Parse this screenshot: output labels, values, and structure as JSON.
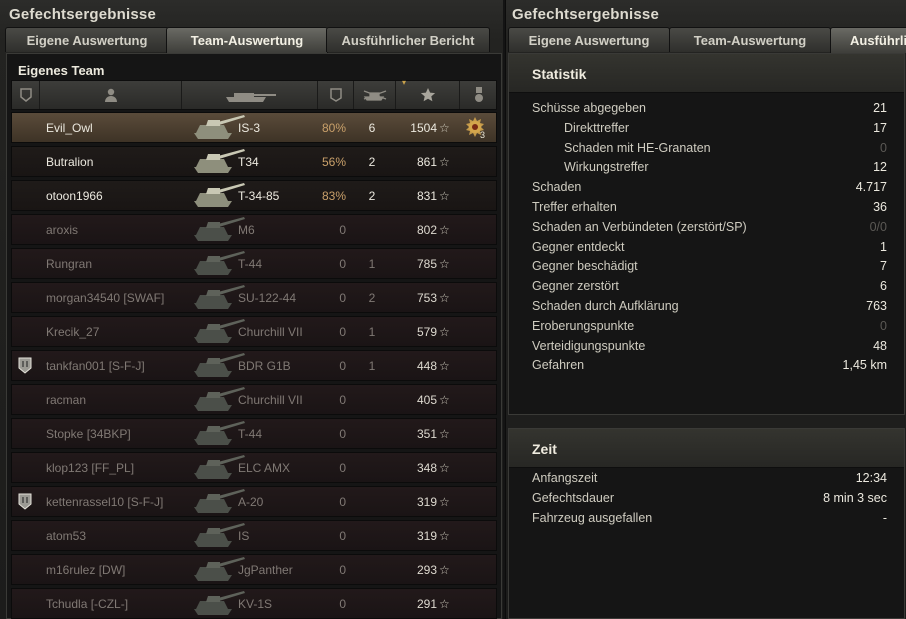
{
  "left": {
    "title": "Gefechtsergebnisse",
    "tabs": [
      "Eigene Auswertung",
      "Team-Auswertung",
      "Ausführlicher Bericht"
    ],
    "team_title": "Eigenes Team",
    "header_icons": [
      "platoon-column-icon",
      "player-column-icon",
      "tank-column-icon",
      "damage-column-icon",
      "kills-column-icon",
      "xp-column-icon",
      "medal-column-icon"
    ],
    "rows": [
      {
        "name": "Evil_Owl",
        "tank": "IS-3",
        "damage_pct": "80%",
        "kills": "6",
        "xp": "1504",
        "state": "self",
        "platoon": false,
        "medal": true,
        "medal_count": "3"
      },
      {
        "name": "Butralion",
        "tank": "T34",
        "damage_pct": "56%",
        "kills": "2",
        "xp": "861",
        "state": "alive",
        "platoon": false
      },
      {
        "name": "otoon1966",
        "tank": "T-34-85",
        "damage_pct": "83%",
        "kills": "2",
        "xp": "831",
        "state": "alive",
        "platoon": false
      },
      {
        "name": "aroxis",
        "tank": "M6",
        "damage_pct": "0",
        "kills": "",
        "xp": "802",
        "state": "dead",
        "platoon": false
      },
      {
        "name": "Rungran",
        "tank": "T-44",
        "damage_pct": "0",
        "kills": "1",
        "xp": "785",
        "state": "dead",
        "platoon": false
      },
      {
        "name": "morgan34540 [SWAF]",
        "tank": "SU-122-44",
        "damage_pct": "0",
        "kills": "2",
        "xp": "753",
        "state": "dead",
        "platoon": false
      },
      {
        "name": "Krecik_27",
        "tank": "Churchill VII",
        "damage_pct": "0",
        "kills": "1",
        "xp": "579",
        "state": "dead",
        "platoon": false
      },
      {
        "name": "tankfan001 [S-F-J]",
        "tank": "BDR G1B",
        "damage_pct": "0",
        "kills": "1",
        "xp": "448",
        "state": "dead",
        "platoon": true
      },
      {
        "name": "racman",
        "tank": "Churchill VII",
        "damage_pct": "0",
        "kills": "",
        "xp": "405",
        "state": "dead",
        "platoon": false
      },
      {
        "name": "Stopke [34BKP]",
        "tank": "T-44",
        "damage_pct": "0",
        "kills": "",
        "xp": "351",
        "state": "dead",
        "platoon": false
      },
      {
        "name": "klop123 [FF_PL]",
        "tank": "ELC AMX",
        "damage_pct": "0",
        "kills": "",
        "xp": "348",
        "state": "dead",
        "platoon": false
      },
      {
        "name": "kettenrassel10 [S-F-J]",
        "tank": "A-20",
        "damage_pct": "0",
        "kills": "",
        "xp": "319",
        "state": "dead",
        "platoon": true
      },
      {
        "name": "atom53",
        "tank": "IS",
        "damage_pct": "0",
        "kills": "",
        "xp": "319",
        "state": "dead",
        "platoon": false
      },
      {
        "name": "m16rulez [DW]",
        "tank": "JgPanther",
        "damage_pct": "0",
        "kills": "",
        "xp": "293",
        "state": "dead",
        "platoon": false
      },
      {
        "name": "Tchudla [-CZL-]",
        "tank": "KV-1S",
        "damage_pct": "0",
        "kills": "",
        "xp": "291",
        "state": "dead",
        "platoon": false
      }
    ]
  },
  "right": {
    "title": "Gefechtsergebnisse",
    "tabs": [
      "Eigene Auswertung",
      "Team-Auswertung",
      "Ausführlic"
    ],
    "statistik": {
      "title": "Statistik",
      "rows": [
        {
          "label": "Schüsse abgegeben",
          "value": "21",
          "indent": false,
          "zero": false
        },
        {
          "label": "Direkttreffer",
          "value": "17",
          "indent": true,
          "zero": false
        },
        {
          "label": "Schaden mit HE-Granaten",
          "value": "0",
          "indent": true,
          "zero": true
        },
        {
          "label": "Wirkungstreffer",
          "value": "12",
          "indent": true,
          "zero": false
        },
        {
          "label": "Schaden",
          "value": "4.717",
          "indent": false,
          "zero": false
        },
        {
          "label": "Treffer erhalten",
          "value": "36",
          "indent": false,
          "zero": false
        },
        {
          "label": "Schaden an Verbündeten (zerstört/SP)",
          "value": "0/0",
          "indent": false,
          "zero": true
        },
        {
          "label": "Gegner entdeckt",
          "value": "1",
          "indent": false,
          "zero": false
        },
        {
          "label": "Gegner beschädigt",
          "value": "7",
          "indent": false,
          "zero": false
        },
        {
          "label": "Gegner zerstört",
          "value": "6",
          "indent": false,
          "zero": false
        },
        {
          "label": "Schaden durch Aufklärung",
          "value": "763",
          "indent": false,
          "zero": false
        },
        {
          "label": "Eroberungspunkte",
          "value": "0",
          "indent": false,
          "zero": true
        },
        {
          "label": "Verteidigungspunkte",
          "value": "48",
          "indent": false,
          "zero": false
        },
        {
          "label": "Gefahren",
          "value": "1,45 km",
          "indent": false,
          "zero": false
        }
      ]
    },
    "zeit": {
      "title": "Zeit",
      "rows": [
        {
          "label": "Anfangszeit",
          "value": "12:34"
        },
        {
          "label": "Gefechtsdauer",
          "value": "8 min 3 sec"
        },
        {
          "label": "Fahrzeug ausgefallen",
          "value": "-"
        }
      ]
    }
  },
  "colors": {
    "accent_gold": "#c9a24c",
    "percent": "#c9a06a",
    "self_row": "#5a4b3a"
  }
}
